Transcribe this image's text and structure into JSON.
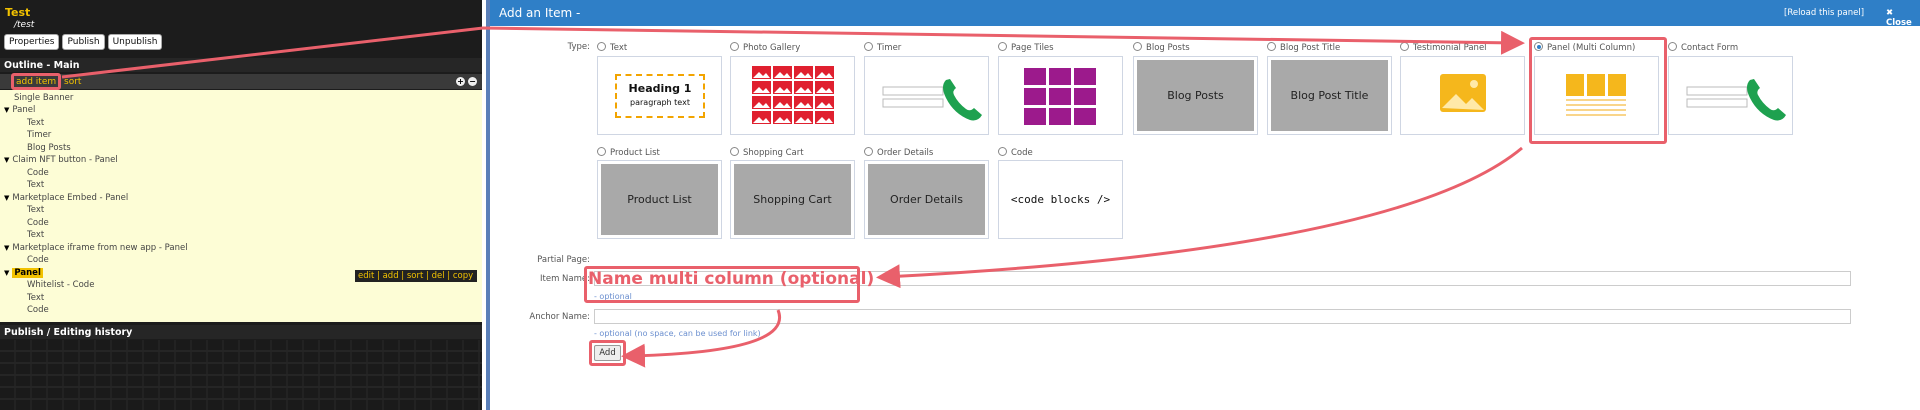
{
  "left": {
    "site_title": "Test",
    "site_path": "/test",
    "buttons": [
      "Properties",
      "Publish",
      "Unpublish"
    ],
    "outline_header": "Outline - Main",
    "add_item": "add item",
    "sort": "sort",
    "plus_glyph": "+",
    "minus_glyph": "−",
    "tree": [
      {
        "label": "Single Banner"
      },
      {
        "label": "Panel",
        "expanded": true
      },
      {
        "label": "Text"
      },
      {
        "label": "Timer"
      },
      {
        "label": "Blog Posts"
      },
      {
        "label": "Claim NFT button - Panel",
        "expanded": true
      },
      {
        "label": "Code"
      },
      {
        "label": "Text"
      },
      {
        "label": "Marketplace Embed - Panel",
        "expanded": true
      },
      {
        "label": "Text"
      },
      {
        "label": "Code"
      },
      {
        "label": "Text"
      },
      {
        "label": "Marketplace iframe from new app - Panel",
        "expanded": true
      },
      {
        "label": "Code"
      },
      {
        "label": "Panel",
        "expanded": true,
        "selected": true
      },
      {
        "label": "Whitelist - Code"
      },
      {
        "label": "Text"
      },
      {
        "label": "Code"
      }
    ],
    "row_actions": "edit | add | sort | del | copy",
    "publish_header": "Publish / Editing history"
  },
  "dialog": {
    "title": "Add an Item -",
    "reload": "[Reload this panel]",
    "close": "Close",
    "type_label": "Type:",
    "types_row1": [
      "Text",
      "Photo Gallery",
      "Timer",
      "Page Tiles",
      "Blog Posts",
      "Blog Post Title",
      "Testimonial Panel",
      "Panel (Multi Column)",
      "Contact Form"
    ],
    "types_row2": [
      "Product List",
      "Shopping Cart",
      "Order Details",
      "Code"
    ],
    "selected_type": "Panel (Multi Column)",
    "tile_text": {
      "heading": "Heading 1",
      "paragraph": "paragraph text",
      "blog_posts": "Blog Posts",
      "blog_post_title": "Blog Post Title",
      "product_list": "Product List",
      "shopping_cart": "Shopping Cart",
      "order_details": "Order Details",
      "code": "<code blocks />"
    },
    "partial_page_label": "Partial Page:",
    "item_name_label": "Item Name:",
    "item_name_hint": "- optional",
    "anchor_name_label": "Anchor Name:",
    "anchor_hint_a": "- optional",
    "anchor_hint_b": "(no space, can be used for link)",
    "add_button": "Add"
  },
  "annotation": {
    "text": "Name multi column (optional)",
    "color": "#e9606b"
  },
  "colors": {
    "titlebar": "#2f7fc7",
    "accent_yellow": "#f2c200",
    "tree_bg": "#fdfdd6"
  }
}
